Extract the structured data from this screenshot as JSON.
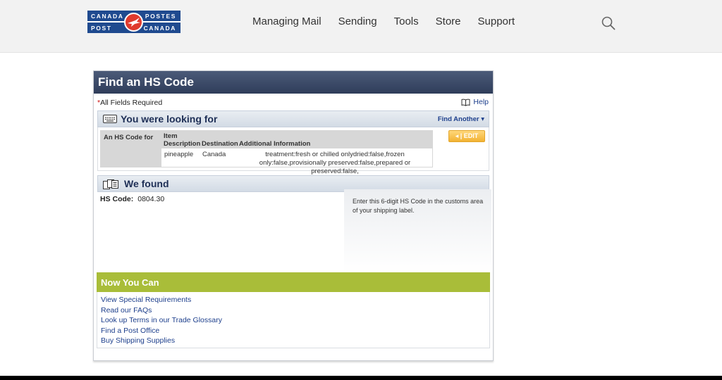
{
  "header": {
    "logo": {
      "top_left": "CANADA",
      "bottom_left": "POST",
      "top_right": "POSTES",
      "bottom_right": "CANADA"
    },
    "nav": [
      "Managing Mail",
      "Sending",
      "Tools",
      "Store",
      "Support"
    ],
    "search_icon": "search-icon"
  },
  "panel": {
    "title": "Find an HS Code",
    "required_note": "All Fields Required",
    "required_star": "*",
    "help_label": "Help",
    "looking_for": {
      "title": "You were looking for",
      "find_another": "Find Another ▾",
      "row_label": "An HS Code for",
      "columns": [
        "Item Description",
        "Destination",
        "Additional Information"
      ],
      "row": {
        "item": "pineapple",
        "destination": "Canada",
        "info": "treatment:fresh or chilled onlydried:false,frozen only:false,provisionally preserved:false,prepared or preserved:false,"
      },
      "edit_label": "◂ | EDIT"
    },
    "found": {
      "title": "We found",
      "hs_label": "HS Code:",
      "hs_value": "0804.30",
      "note": "Enter this 6-digit HS Code in the customs area of your shipping label."
    },
    "now_you_can": {
      "title": "Now You Can",
      "links": [
        "View Special Requirements",
        "Read our FAQs",
        "Look up Terms in our Trade Glossary",
        "Find a Post Office",
        "Buy Shipping Supplies"
      ]
    }
  },
  "colors": {
    "brand_blue": "#1f4a8f",
    "brand_red": "#e03a2d",
    "title_bar": "#3a4866",
    "green_bar": "#a9bd39",
    "link": "#1d3f8c",
    "edit_button": "#f2b233"
  }
}
